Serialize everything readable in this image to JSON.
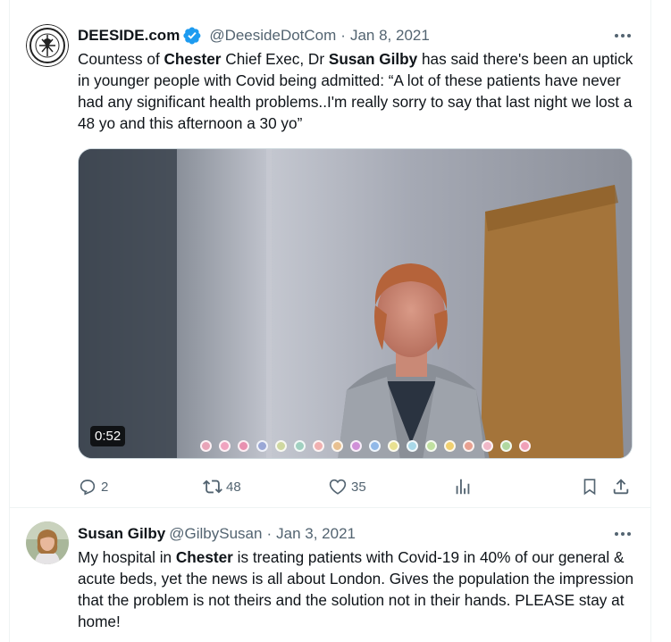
{
  "tweets": [
    {
      "display_name": "DEESIDE.com",
      "verified": true,
      "handle": "@DeesideDotCom",
      "separator": "·",
      "date": "Jan 8, 2021",
      "avatar_icon": "deeside-logo",
      "avatar_text": "DEESIDE DOT COM",
      "text_parts": [
        "Countess of ",
        "Chester",
        " Chief Exec, Dr ",
        "Susan Gilby",
        " has said there's been an uptick in younger people with Covid being admitted: “A lot of these patients have never had any significant health problems..I'm really sorry to say that last night we lost a 48 yo and this afternoon a 30 yo”"
      ],
      "media": {
        "type": "video",
        "duration": "0:52"
      },
      "actions": {
        "replies": "2",
        "retweets": "48",
        "likes": "35"
      }
    },
    {
      "display_name": "Susan Gilby",
      "handle": "@GilbySusan",
      "separator": "·",
      "date": "Jan 3, 2021",
      "avatar_icon": "user-photo",
      "text_parts": [
        "My hospital in ",
        "Chester",
        " is treating patients with Covid-19 in 40% of our general & acute beds, yet the news is all about London. Gives the population the impression that the problem is not theirs and the solution not in their hands. PLEASE stay at home!"
      ]
    }
  ],
  "colors": {
    "text": "#0f1419",
    "secondary": "#536471",
    "verified": "#1d9bf0",
    "border": "#eff3f4"
  }
}
